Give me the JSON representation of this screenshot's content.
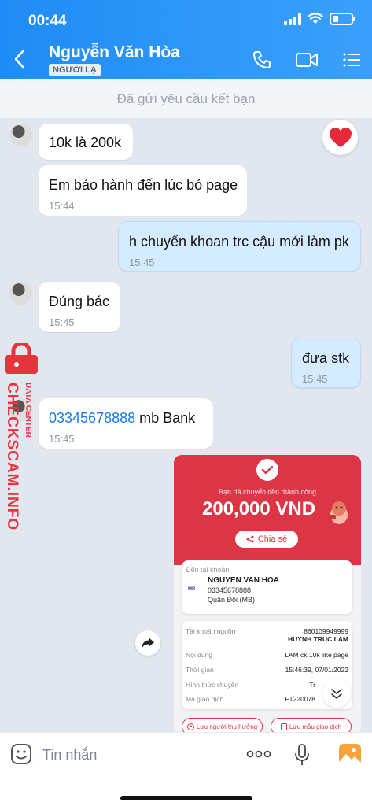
{
  "status_bar": {
    "time": "00:44"
  },
  "header": {
    "contact_name": "Nguyễn Văn Hòa",
    "badge": "NGƯỜI LẠ",
    "icons": [
      "back-arrow-icon",
      "phone-icon",
      "video-call-icon",
      "menu-list-icon"
    ]
  },
  "friend_request": {
    "text": "Đã gửi yêu cầu kết bạn"
  },
  "messages": [
    {
      "direction": "in",
      "text": "10k là 200k",
      "time": ""
    },
    {
      "direction": "in",
      "text": "Em bảo hành đến lúc bỏ page",
      "time": "15:44"
    },
    {
      "direction": "out",
      "text": "h chuyển khoan trc cậu mới làm pk",
      "time": "15:45"
    },
    {
      "direction": "in",
      "text": "Đúng bác",
      "time": "15:45"
    },
    {
      "direction": "out",
      "text": "đưa stk",
      "time": "15:45"
    },
    {
      "direction": "in",
      "link": "03345678888",
      "text": " mb Bank",
      "time": "15:45"
    }
  ],
  "reaction": {
    "icon": "heart-icon"
  },
  "watermark": {
    "main": "CHECKSCAM.INFO",
    "sub": "DATA CENTER"
  },
  "receipt": {
    "success_text": "Bạn đã chuyển tiền thành công",
    "amount": "200,000 VND",
    "share_label": "Chia sẻ",
    "to_label": "Đến tài khoản",
    "to_name": "NGUYEN VAN HOA",
    "to_account": "03345678888",
    "to_bank": "Quân Đội (MB)",
    "bank_logo_text": "MB",
    "source_label": "Tài khoản nguồn",
    "source_account": "860109949999",
    "source_name": "HUYNH TRUC LAM",
    "content_label": "Nội dung",
    "content_value": "LAM ck 10k like page",
    "time_label": "Thời gian",
    "time_value": "15:46:39, 07/01/2022",
    "method_label": "Hình thức chuyển",
    "method_value": "Tr",
    "txn_label": "Mã giao dịch",
    "txn_value": "FT220078",
    "save_recipient": "Lưu người thụ hưởng",
    "save_template": "Lưu mẫu giao dịch"
  },
  "input_bar": {
    "placeholder": "Tin nhắn"
  }
}
